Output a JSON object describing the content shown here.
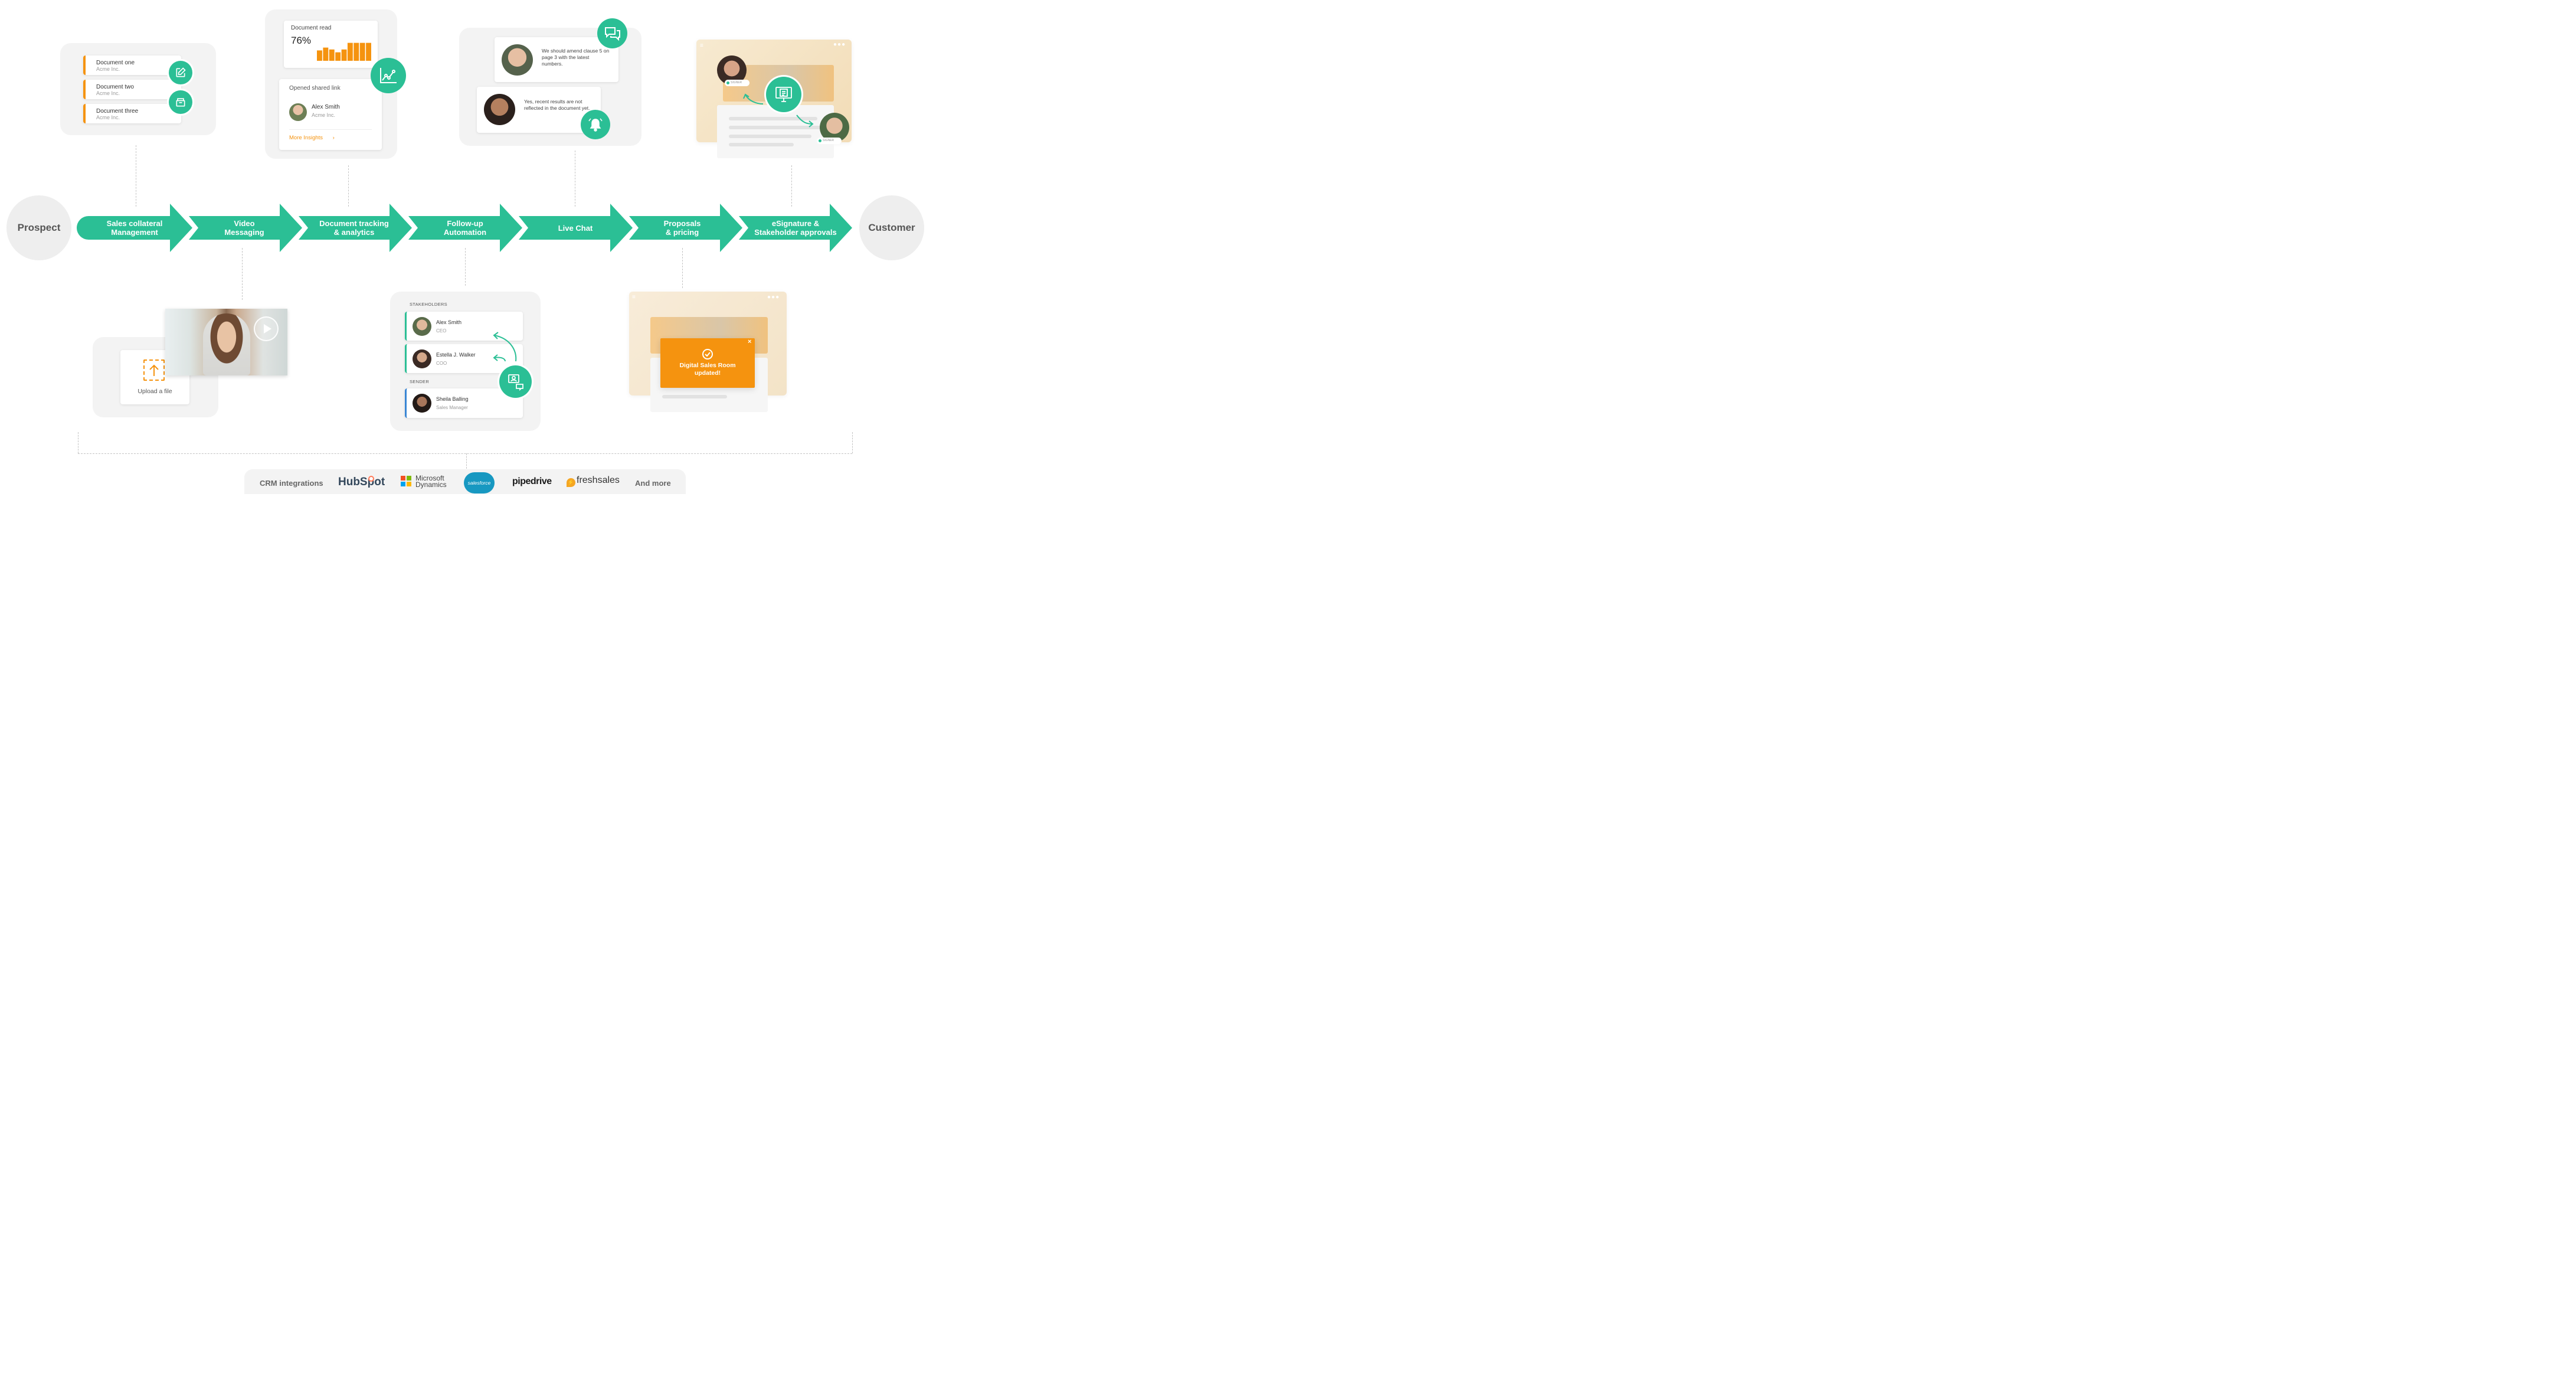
{
  "colors": {
    "teal": "#2bbf95",
    "orange": "#f5930f",
    "panel": "#f3f3f3",
    "blue": "#3a86d4"
  },
  "start_label": "Prospect",
  "end_label": "Customer",
  "steps": [
    {
      "line1": "Sales collateral",
      "line2": "Management"
    },
    {
      "line1": "Video",
      "line2": "Messaging"
    },
    {
      "line1": "Document tracking",
      "line2": "& analytics"
    },
    {
      "line1": "Follow-up",
      "line2": "Automation"
    },
    {
      "line1": "Live Chat",
      "line2": ""
    },
    {
      "line1": "Proposals",
      "line2": "& pricing"
    },
    {
      "line1": "eSignature &",
      "line2": "Stakeholder approvals"
    }
  ],
  "collateral": {
    "docs": [
      {
        "title": "Document one",
        "sub": "Acme Inc."
      },
      {
        "title": "Document two",
        "sub": "Acme Inc."
      },
      {
        "title": "Document three",
        "sub": "Acme Inc."
      }
    ],
    "icons": [
      "edit-icon",
      "folder-icon"
    ]
  },
  "tracking": {
    "read_title": "Document read",
    "read_value": "76%",
    "bars": [
      0.55,
      0.7,
      0.6,
      0.45,
      0.6,
      0.95,
      0.95,
      0.95,
      0.95
    ],
    "shared_title": "Opened shared link",
    "person": "Alex Smith",
    "company": "Acme Inc.",
    "more": "More Insights",
    "icon": "line-chart-icon"
  },
  "chat": {
    "msg1": "We should amend clause 5 on page 3 with the latest numbers.",
    "msg2": "Yes, recent results are not reflected in the document yet.",
    "icons": [
      "chat-icon",
      "bell-icon"
    ]
  },
  "esign": {
    "badge1": "SIGNER",
    "badge2": "SIGNER",
    "icon": "document-sign-icon"
  },
  "video": {
    "upload_label": "Upload a file",
    "icons": [
      "upload-icon",
      "play-icon"
    ]
  },
  "followup": {
    "stakeholders_heading": "STAKEHOLDERS",
    "sender_heading": "SENDER",
    "people": [
      {
        "name": "Alex Smith",
        "role": "CEO"
      },
      {
        "name": "Estella J. Walker",
        "role": "COO"
      }
    ],
    "sender": {
      "name": "Sheila Balling",
      "role": "Sales Manager"
    },
    "icon": "people-chat-icon"
  },
  "proposal": {
    "toast_line1": "Digital Sales Room",
    "toast_line2": "updated!",
    "close": "×"
  },
  "crm": {
    "label": "CRM integrations",
    "logos": [
      "HubSpot",
      "Microsoft",
      "Dynamics",
      "salesforce",
      "pipedrive",
      "freshsales"
    ],
    "more": "And more"
  }
}
